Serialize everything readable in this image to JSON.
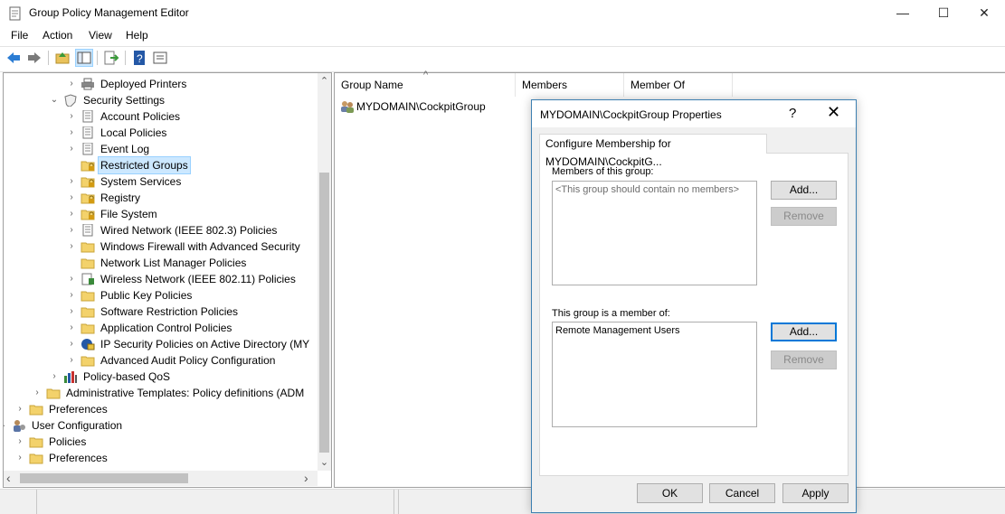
{
  "window": {
    "title": "Group Policy Management Editor",
    "minimize": "—",
    "maximize": "☐",
    "close": "✕"
  },
  "menu": [
    "File",
    "Action",
    "View",
    "Help"
  ],
  "toolbar": {
    "back": "back-arrow-icon",
    "forward": "forward-arrow-icon",
    "up": "up-folder-icon",
    "show_hide_tree": "console-tree-icon",
    "export": "export-list-icon",
    "help": "help-icon",
    "properties": "properties-icon"
  },
  "tree": {
    "items": [
      {
        "label": "Deployed Printers",
        "icon": "printer-icon",
        "chevron": "›"
      },
      {
        "label": "Security Settings",
        "icon": "security-settings-icon",
        "chevron": "⌄"
      },
      {
        "label": "Account Policies",
        "icon": "policy-doc-icon",
        "chevron": "›"
      },
      {
        "label": "Local Policies",
        "icon": "policy-doc-icon",
        "chevron": "›"
      },
      {
        "label": "Event Log",
        "icon": "policy-doc-icon",
        "chevron": "›"
      },
      {
        "label": "Restricted Groups",
        "icon": "locked-folder-icon",
        "chevron": ""
      },
      {
        "label": "System Services",
        "icon": "locked-folder-icon",
        "chevron": "›"
      },
      {
        "label": "Registry",
        "icon": "locked-folder-icon",
        "chevron": "›"
      },
      {
        "label": "File System",
        "icon": "locked-folder-icon",
        "chevron": "›"
      },
      {
        "label": "Wired Network (IEEE 802.3) Policies",
        "icon": "network-doc-icon",
        "chevron": "›"
      },
      {
        "label": "Windows Firewall with Advanced Security",
        "icon": "folder-icon",
        "chevron": "›"
      },
      {
        "label": "Network List Manager Policies",
        "icon": "folder-icon",
        "chevron": ""
      },
      {
        "label": "Wireless Network (IEEE 802.11) Policies",
        "icon": "wireless-icon",
        "chevron": "›"
      },
      {
        "label": "Public Key Policies",
        "icon": "folder-icon",
        "chevron": "›"
      },
      {
        "label": "Software Restriction Policies",
        "icon": "folder-icon",
        "chevron": "›"
      },
      {
        "label": "Application Control Policies",
        "icon": "folder-icon",
        "chevron": "›"
      },
      {
        "label": "IP Security Policies on Active Directory (MY",
        "icon": "ipsec-icon",
        "chevron": "›"
      },
      {
        "label": "Advanced Audit Policy Configuration",
        "icon": "folder-icon",
        "chevron": "›"
      },
      {
        "label": "Policy-based QoS",
        "icon": "qos-chart-icon",
        "chevron": "›"
      },
      {
        "label": "Administrative Templates: Policy definitions (ADM",
        "icon": "folder-icon",
        "chevron": "›"
      },
      {
        "label": "Preferences",
        "icon": "folder-icon",
        "chevron": "›"
      },
      {
        "label": "User Configuration",
        "icon": "user-config-icon",
        "chevron": "⌄"
      },
      {
        "label": "Policies",
        "icon": "folder-icon",
        "chevron": "›"
      },
      {
        "label": "Preferences",
        "icon": "folder-icon",
        "chevron": "›"
      }
    ],
    "selected": "Restricted Groups",
    "scroll_left": "‹",
    "scroll_right": "›",
    "scroll_up": "⌃",
    "scroll_down": "⌄"
  },
  "list": {
    "columns": [
      "Group Name",
      "Members",
      "Member Of"
    ],
    "sort_indicator": "^",
    "rows": [
      {
        "name": "MYDOMAIN\\CockpitGroup",
        "icon": "group-icon"
      }
    ]
  },
  "dialog": {
    "title": "MYDOMAIN\\CockpitGroup Properties",
    "help": "?",
    "close": "✕",
    "tab": "Configure Membership for MYDOMAIN\\CockpitG...",
    "members_label": "Members of this group:",
    "members_placeholder": "<This group should contain no members>",
    "members_add": "Add...",
    "members_remove": "Remove",
    "memberof_label": "This group is a member of:",
    "memberof_items": [
      "Remote Management Users"
    ],
    "memberof_add": "Add...",
    "memberof_remove": "Remove",
    "ok": "OK",
    "cancel": "Cancel",
    "apply": "Apply"
  }
}
